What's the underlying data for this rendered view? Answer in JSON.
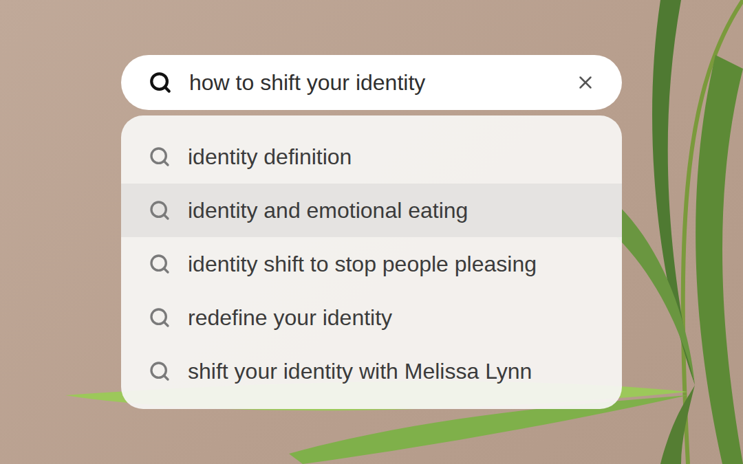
{
  "search": {
    "query": "how to shift your identity"
  },
  "suggestions": [
    {
      "label": "identity definition",
      "selected": false
    },
    {
      "label": "identity and emotional eating",
      "selected": true
    },
    {
      "label": "identity shift to stop people pleasing",
      "selected": false
    },
    {
      "label": "redefine your identity",
      "selected": false
    },
    {
      "label": "shift your identity with Melissa Lynn",
      "selected": false
    }
  ]
}
